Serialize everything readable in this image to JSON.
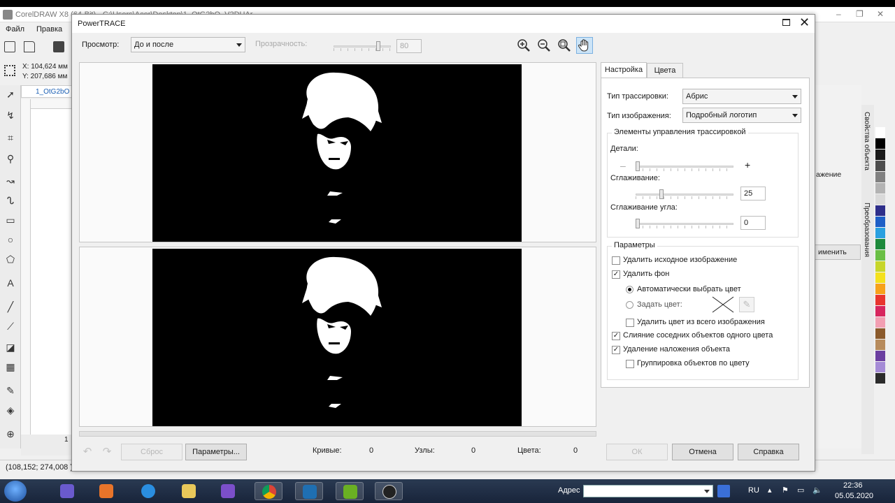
{
  "app": {
    "title": "CorelDRAW X8 (64-Bit) - C:\\Users\\Acer\\Desktop\\1_OtG2bO_V2DUAr...",
    "menu": [
      "Файл",
      "Правка"
    ],
    "coord_x": "X: 104,624 мм",
    "coord_y": "Y: 207,686 мм",
    "doc_tab": "1_OtG2bO",
    "page_num": "1",
    "status": "(108,152; 274,008 )",
    "right_frag1": "ажение",
    "right_frag2": "именить",
    "vtabs": [
      "Свойства объекта",
      "Преобразования"
    ],
    "palette": [
      "#ffffff",
      "#000000",
      "#1a1a1a",
      "#4d4d4d",
      "#808080",
      "#b3b3b3",
      "#d9d9d9",
      "#2e2e8a",
      "#1e5fc7",
      "#2aa0e0",
      "#1d8a3c",
      "#6abf45",
      "#c7d62a",
      "#f4e11d",
      "#f7a21b",
      "#e8352e",
      "#d7265e",
      "#f29fb2",
      "#8b5a2b",
      "#b78b5c",
      "#6b3fa0",
      "#a58bd6",
      "#2b2b2b"
    ]
  },
  "dialog": {
    "title": "PowerTRACE",
    "preview_label": "Просмотр:",
    "preview_value": "До и после",
    "transparency_label": "Прозрачность:",
    "transparency_value": "80",
    "tabs": [
      "Настройка",
      "Цвета"
    ],
    "trace_type_label": "Тип трассировки:",
    "trace_type_value": "Абрис",
    "image_type_label": "Тип изображения:",
    "image_type_value": "Подробный логотип",
    "controls_group": "Элементы управления трассировкой",
    "detail_label": "Детали:",
    "detail_minus": "–",
    "detail_plus": "+",
    "smoothing_label": "Сглаживание:",
    "smoothing_value": "25",
    "corner_label": "Сглаживание угла:",
    "corner_value": "0",
    "params_group": "Параметры",
    "opt_remove_original": "Удалить исходное изображение",
    "opt_remove_bg": "Удалить фон",
    "opt_auto_color": "Автоматически выбрать цвет",
    "opt_set_color": "Задать цвет:",
    "opt_remove_color_all": "Удалить цвет из всего изображения",
    "opt_merge": "Слияние соседних объектов одного цвета",
    "opt_remove_overlap": "Удаление наложения объекта",
    "opt_group_by_color": "Группировка объектов по цвету",
    "checks": {
      "remove_original": false,
      "remove_bg": true,
      "remove_color_all": false,
      "merge": true,
      "remove_overlap": true,
      "group_by_color": false
    },
    "reset_label": "Сброс",
    "params_button": "Параметры...",
    "curves_label": "Кривые:",
    "curves_value": "0",
    "nodes_label": "Узлы:",
    "nodes_value": "0",
    "colors_label": "Цвета:",
    "colors_value": "0",
    "ok_label": "ОК",
    "cancel_label": "Отмена",
    "help_label": "Справка",
    "sliders": {
      "detail": 0.0,
      "smoothing": 0.25,
      "corner": 0.0,
      "transparency": 0.8
    }
  },
  "taskbar": {
    "address_label": "Адрес",
    "lang": "RU",
    "time": "22:36",
    "date": "05.05.2020"
  }
}
